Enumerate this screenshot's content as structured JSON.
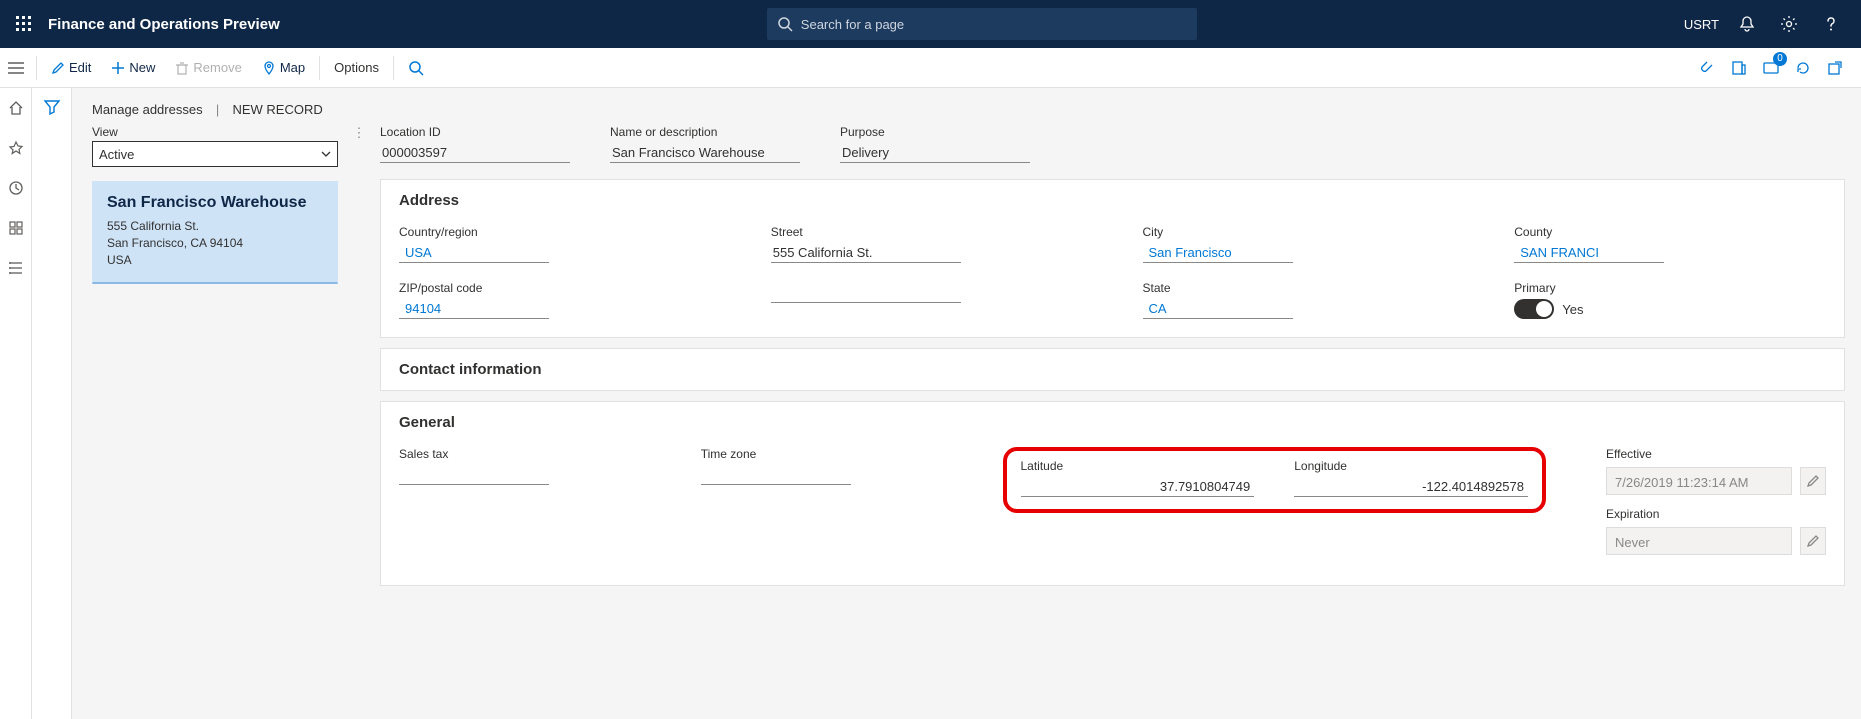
{
  "header": {
    "title": "Finance and Operations Preview",
    "search_placeholder": "Search for a page",
    "entity": "USRT"
  },
  "actionbar": {
    "edit": "Edit",
    "new": "New",
    "remove": "Remove",
    "map": "Map",
    "options": "Options",
    "msg_count": "0"
  },
  "breadcrumb": {
    "page": "Manage addresses",
    "record": "NEW RECORD"
  },
  "view": {
    "label": "View",
    "value": "Active"
  },
  "card": {
    "title": "San Francisco Warehouse",
    "line1": "555 California St.",
    "line2": "San Francisco, CA 94104",
    "line3": "USA"
  },
  "summary": {
    "location_label": "Location ID",
    "location_value": "000003597",
    "name_label": "Name or description",
    "name_value": "San Francisco Warehouse",
    "purpose_label": "Purpose",
    "purpose_value": "Delivery"
  },
  "sections": {
    "address": "Address",
    "contact": "Contact information",
    "general": "General"
  },
  "address": {
    "country_label": "Country/region",
    "country_value": "USA",
    "street_label": "Street",
    "street_value": "555 California St.",
    "city_label": "City",
    "city_value": "San Francisco",
    "county_label": "County",
    "county_value": "SAN FRANCI",
    "zip_label": "ZIP/postal code",
    "zip_value": "94104",
    "state_label": "State",
    "state_value": "CA",
    "primary_label": "Primary",
    "primary_text": "Yes"
  },
  "general": {
    "salestax_label": "Sales tax",
    "timezone_label": "Time zone",
    "lat_label": "Latitude",
    "lat_value": "37.7910804749",
    "lon_label": "Longitude",
    "lon_value": "-122.4014892578",
    "effective_label": "Effective",
    "effective_value": "7/26/2019 11:23:14 AM",
    "expiration_label": "Expiration",
    "expiration_value": "Never"
  }
}
